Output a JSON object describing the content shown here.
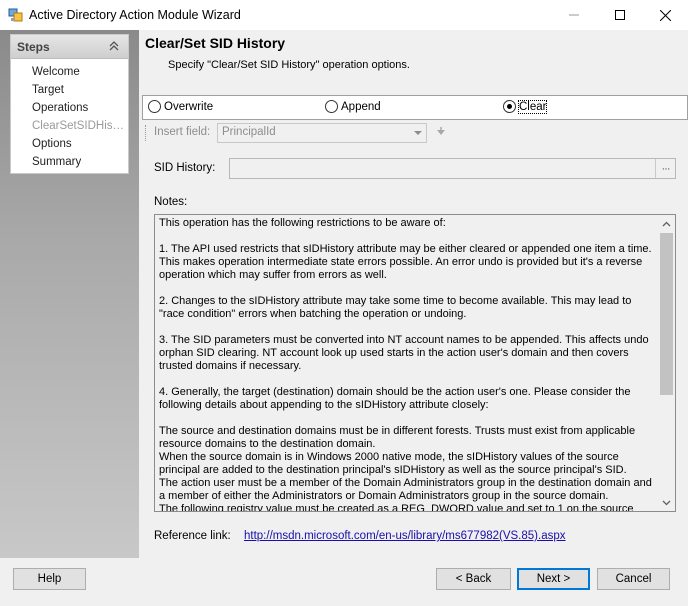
{
  "window": {
    "title": "Active Directory Action Module Wizard",
    "minimize_glyph": "—",
    "maximize_glyph": "☐",
    "close_glyph": "✕"
  },
  "sidebar": {
    "header": "Steps",
    "items": [
      {
        "label": "Welcome",
        "active": false
      },
      {
        "label": "Target",
        "active": false
      },
      {
        "label": "Operations",
        "active": false
      },
      {
        "label": "ClearSetSIDHis…",
        "active": true
      },
      {
        "label": "Options",
        "active": false
      },
      {
        "label": "Summary",
        "active": false
      }
    ]
  },
  "page": {
    "title": "Clear/Set SID History",
    "subtitle": "Specify \"Clear/Set SID History\" operation options."
  },
  "operation": {
    "options": [
      {
        "label": "Overwrite",
        "checked": false
      },
      {
        "label": "Append",
        "checked": false
      },
      {
        "label": "Clear",
        "checked": true
      }
    ]
  },
  "insert_field": {
    "label": "Insert field:",
    "value": "PrincipalId"
  },
  "sid_history": {
    "label": "SID History:",
    "value": "",
    "browse_label": "···"
  },
  "notes": {
    "label": "Notes:",
    "text": "This operation has the following restrictions to be aware of:\n\n1. The API used restricts that sIDHistory attribute may be either cleared or appended one item a time. This makes operation intermediate state errors possible. An error undo is provided but it's a reverse operation which may suffer from errors as well.\n\n2. Changes to the sIDHistory attribute may take some time to become available. This may lead to \"race condition\" errors when batching the operation or undoing.\n\n3. The SID parameters must be converted into NT account names to be appended. This affects undo orphan SID clearing. NT account look up used starts in the action user's domain and then covers trusted domains if necessary.\n\n4. Generally, the target (destination) domain should be the action user's one. Please consider the following details about appending to the sIDHistory attribute closely:\n\nThe source and destination domains must be in different forests. Trusts must exist from applicable resource domains to the destination domain.\nWhen the source domain is in Windows 2000 native mode, the sIDHistory values of the source principal are added to the destination principal's sIDHistory as well as the source principal's SID.\nThe action user must be a member of the Domain Administrators group in the destination domain and a member of either the Administrators or Domain Administrators group in the source domain.\nThe following registry value must be created as a REG_DWORD value and set to 1 on the source"
  },
  "reference": {
    "label": "Reference link:",
    "url": "http://msdn.microsoft.com/en-us/library/ms677982(VS.85).aspx"
  },
  "buttons": {
    "help": "Help",
    "back": "< Back",
    "next": "Next >",
    "cancel": "Cancel"
  },
  "colors": {
    "link": "#1a0dab",
    "default_button_border": "#0078d7",
    "sidebar_gradient_top": "#8a8a8a",
    "sidebar_gradient_bottom": "#c8c8c8"
  },
  "icons": {
    "app": "app-icon",
    "collapse": "chevron-up-double-icon",
    "insert": "insert-field-arrow-icon",
    "scroll_up": "scroll-up-icon",
    "scroll_down": "scroll-down-icon"
  }
}
